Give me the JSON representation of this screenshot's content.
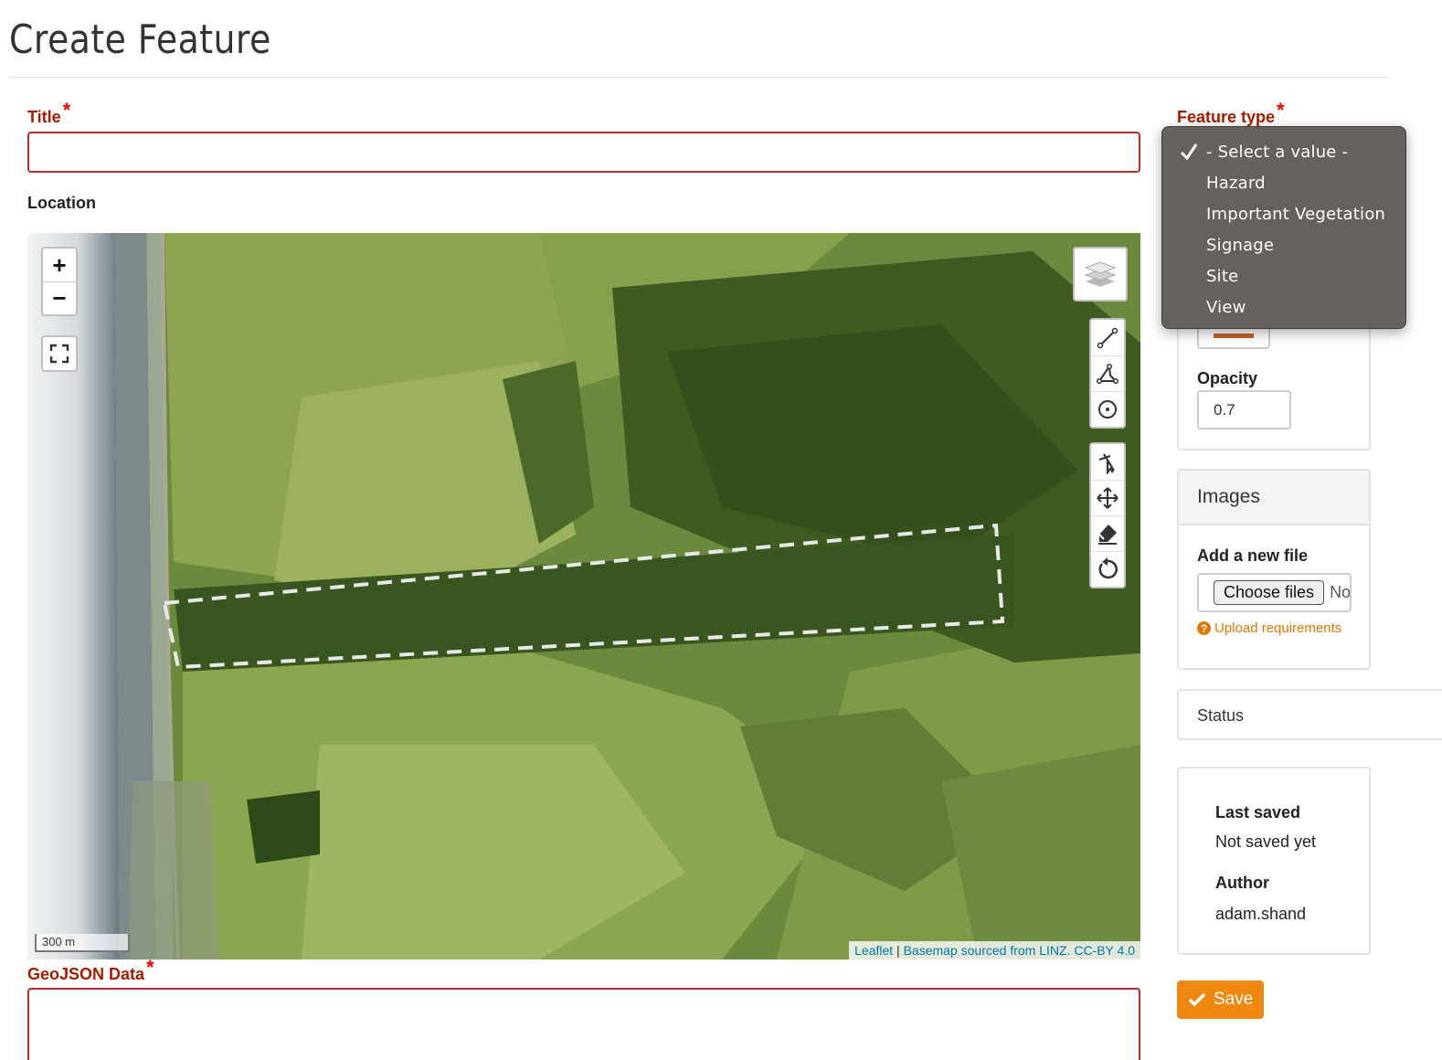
{
  "page": {
    "title": "Create Feature"
  },
  "form": {
    "title_label": "Title",
    "required_mark": "*",
    "location_label": "Location",
    "geojson_label": "GeoJSON Data",
    "feature_type_label": "Feature type"
  },
  "feature_type": {
    "options": [
      {
        "label": "- Select a value -",
        "selected": true
      },
      {
        "label": "Hazard",
        "selected": false
      },
      {
        "label": "Important Vegetation",
        "selected": false
      },
      {
        "label": "Signage",
        "selected": false
      },
      {
        "label": "Site",
        "selected": false
      },
      {
        "label": "View",
        "selected": false
      }
    ]
  },
  "map": {
    "zoom_in": "+",
    "zoom_out": "−",
    "scale": "300 m",
    "attribution": {
      "leaflet": "Leaflet",
      "separator": " | ",
      "source": "Basemap sourced from LINZ. CC-BY 4.0"
    },
    "icons": {
      "fullscreen": "fullscreen-icon",
      "layers": "layers-icon",
      "line": "draw-polyline-icon",
      "polygon": "draw-polygon-icon",
      "circle": "draw-circle-icon",
      "marker": "draw-marker-icon",
      "move": "move-icon",
      "erase": "erase-icon",
      "rotate": "rotate-icon"
    }
  },
  "style": {
    "opacity_label": "Opacity",
    "opacity_value": "0.7",
    "color_swatch": "#c8602a"
  },
  "images": {
    "heading": "Images",
    "add_file_label": "Add a new file",
    "choose_button": "Choose files",
    "no_file_text": "No file chosen",
    "upload_req": "Upload requirements"
  },
  "status": {
    "heading": "Status"
  },
  "meta": {
    "last_saved_label": "Last saved",
    "last_saved_value": "Not saved yet",
    "author_label": "Author",
    "author_value": "adam.shand"
  },
  "actions": {
    "save": "Save"
  },
  "colors": {
    "required": "#a51b00",
    "accent": "#f0870f",
    "link": "#0078a8"
  }
}
